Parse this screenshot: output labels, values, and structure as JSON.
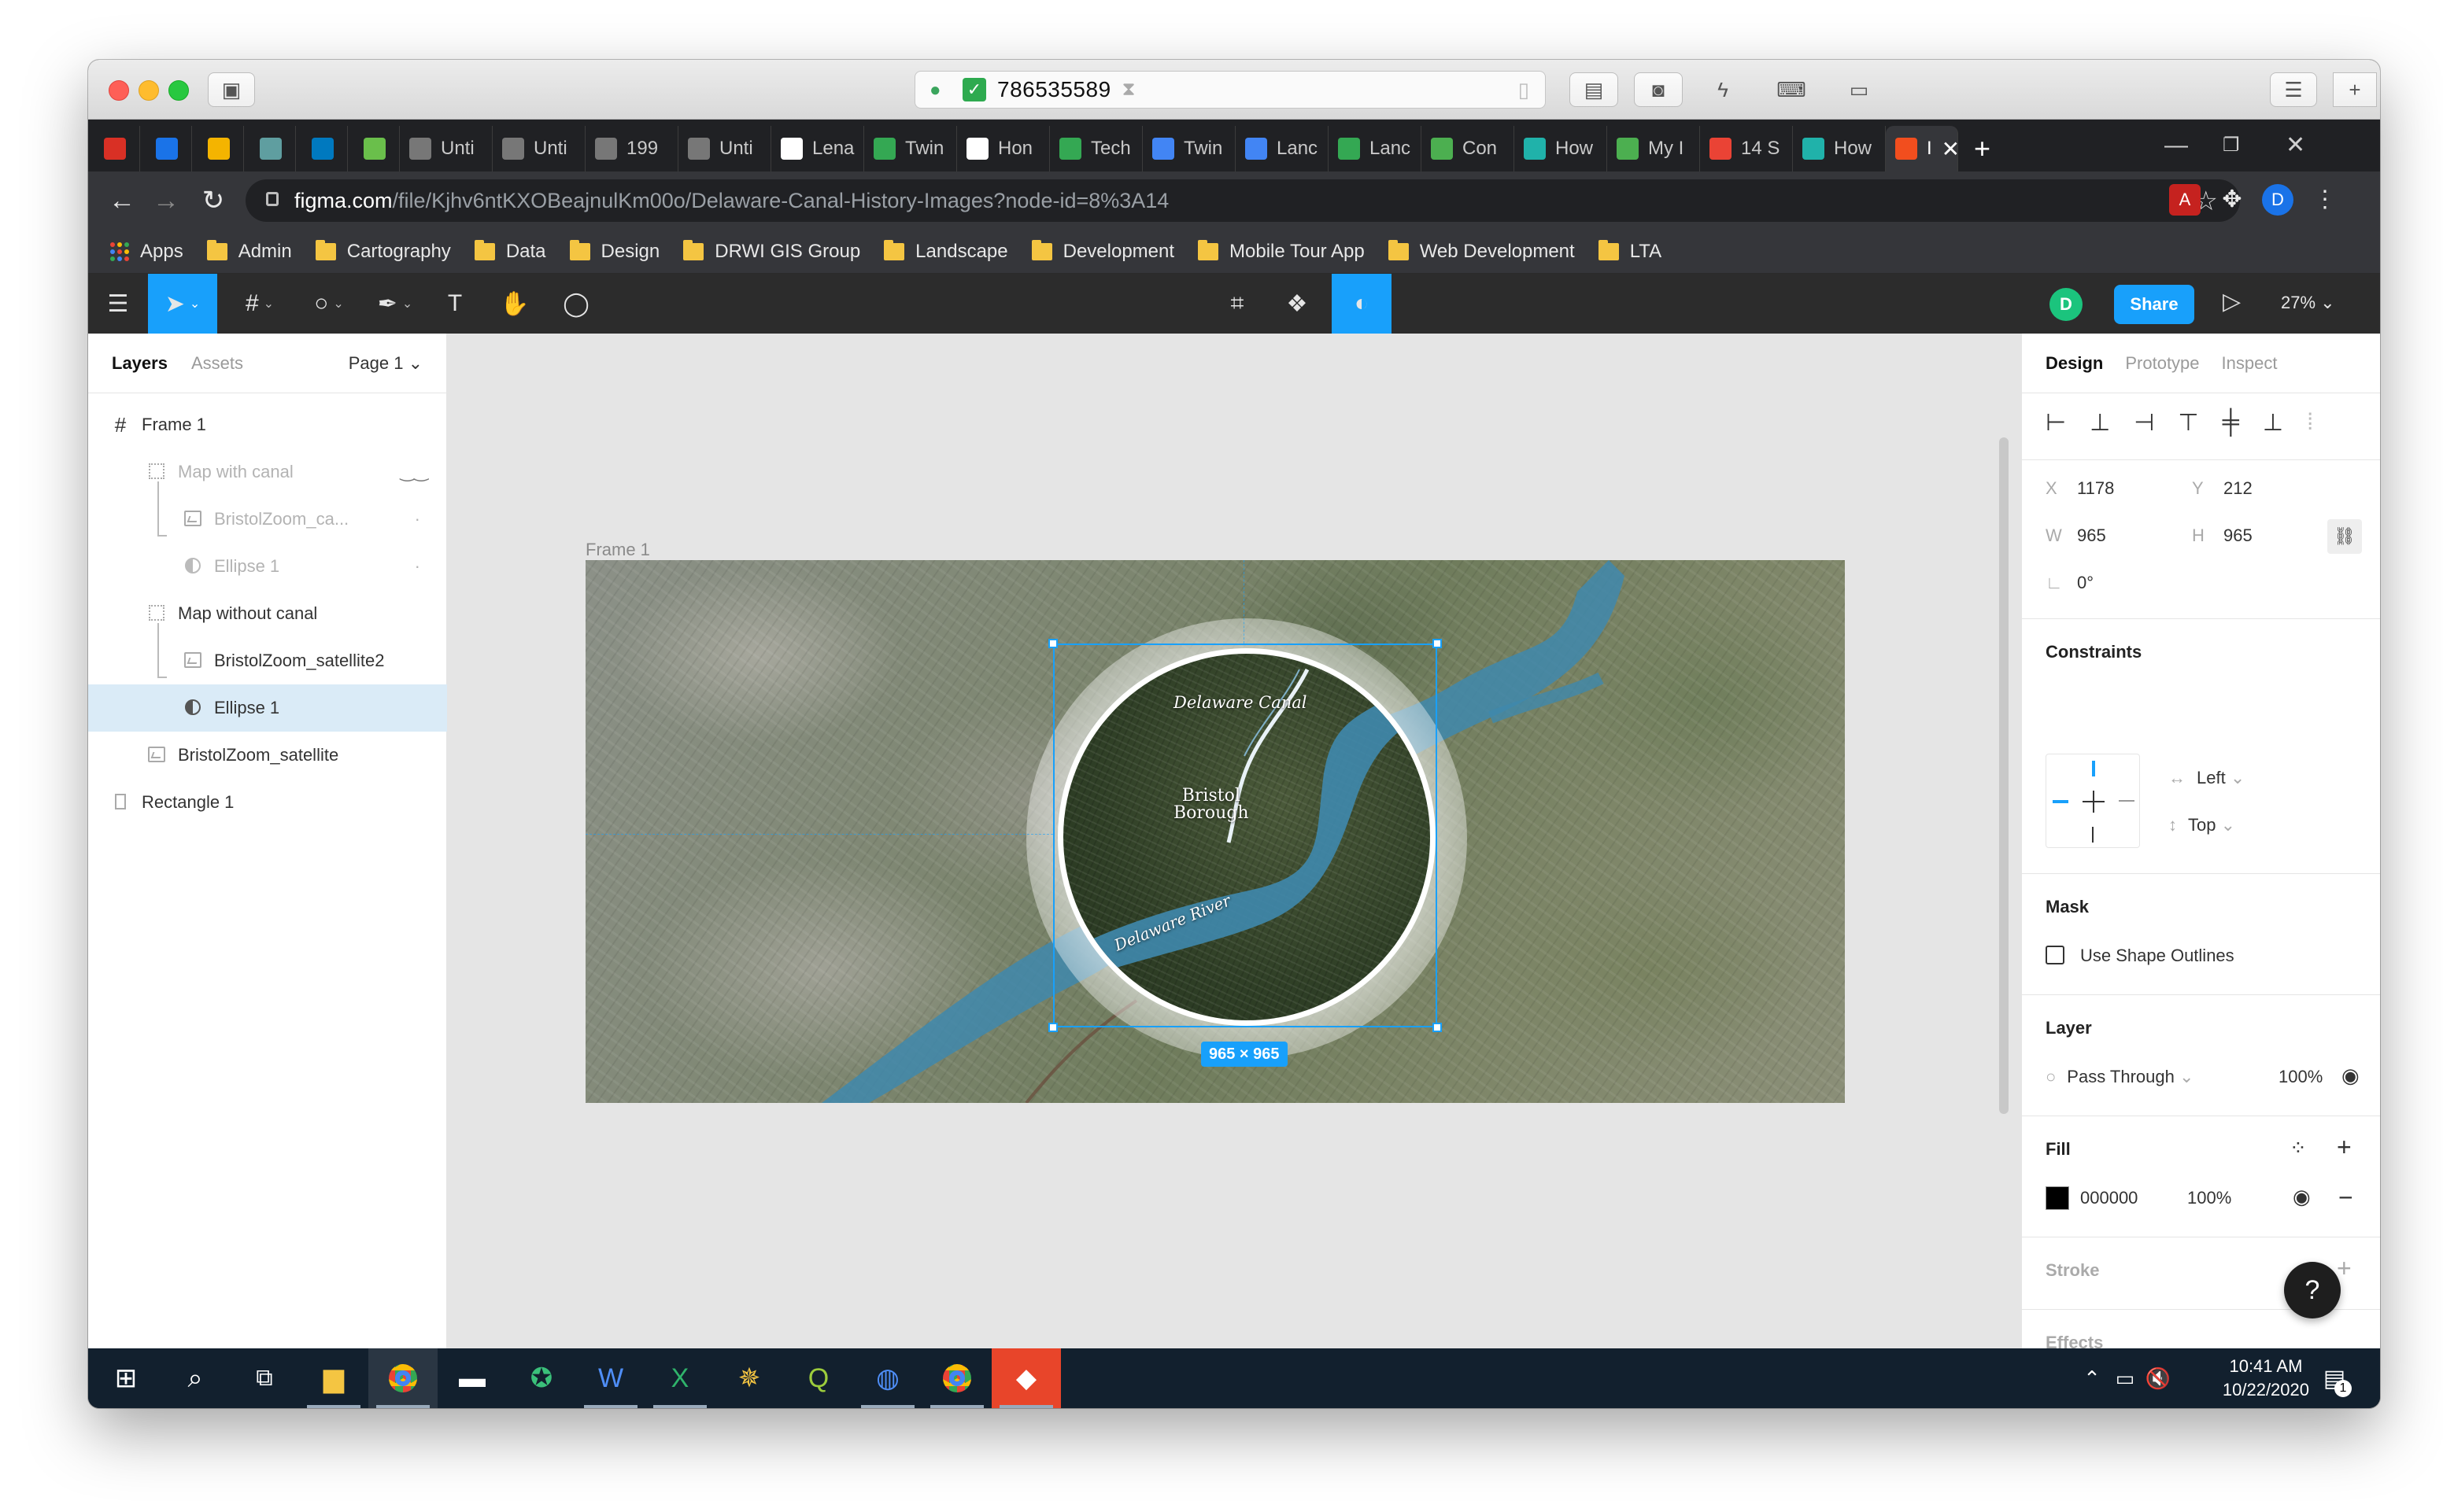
{
  "mac": {
    "address_id": "786535589"
  },
  "tabs": [
    {
      "label": "",
      "icon": "gmail-icon",
      "color": "#d93025"
    },
    {
      "label": "",
      "icon": "calendar-icon",
      "color": "#1a73e8"
    },
    {
      "label": "",
      "icon": "drive-icon",
      "color": "#f4b400"
    },
    {
      "label": "",
      "icon": "grid-app-icon",
      "color": "#5f9ea0"
    },
    {
      "label": "",
      "icon": "trello-icon",
      "color": "#0079bf"
    },
    {
      "label": "",
      "icon": "tab-green-icon",
      "color": "#6abf4b"
    },
    {
      "label": "Unti",
      "icon": "loading-icon",
      "color": "#777777"
    },
    {
      "label": "Unti",
      "icon": "loading-icon",
      "color": "#777777"
    },
    {
      "label": "199",
      "icon": "loading-icon",
      "color": "#777777"
    },
    {
      "label": "Unti",
      "icon": "loading-icon",
      "color": "#777777"
    },
    {
      "label": "Lena",
      "icon": "wikipedia-icon",
      "color": "#ffffff"
    },
    {
      "label": "Twin",
      "icon": "doc-green-icon",
      "color": "#34a853"
    },
    {
      "label": "Hon",
      "icon": "wix-icon",
      "color": "#ffffff"
    },
    {
      "label": "Tech",
      "icon": "plus-green-icon",
      "color": "#34a853"
    },
    {
      "label": "Twin",
      "icon": "docs-icon",
      "color": "#4285f4"
    },
    {
      "label": "Lanc",
      "icon": "docs-icon",
      "color": "#4285f4"
    },
    {
      "label": "Lanc",
      "icon": "plus-green-icon",
      "color": "#34a853"
    },
    {
      "label": "Con",
      "icon": "globe-icon",
      "color": "#4caf50"
    },
    {
      "label": "How",
      "icon": "qgis-icon",
      "color": "#20b2aa"
    },
    {
      "label": "My I",
      "icon": "globe-icon",
      "color": "#4caf50"
    },
    {
      "label": "14 S",
      "icon": "maps-pin-icon",
      "color": "#ea4335"
    },
    {
      "label": "How",
      "icon": "qgis-icon",
      "color": "#20b2aa"
    },
    {
      "label": "I",
      "icon": "figma-icon",
      "color": "#f24e1e",
      "active": true
    }
  ],
  "browser": {
    "url_host": "figma.com",
    "url_path": "/file/Kjhv6ntKXOBeajnulKm00o/Delaware-Canal-History-Images?node-id=8%3A14",
    "profile_initial": "D"
  },
  "bookmarks": [
    "Apps",
    "Admin",
    "Cartography",
    "Data",
    "Design",
    "DRWI GIS Group",
    "Landscape",
    "Development",
    "Mobile Tour App",
    "Web Development",
    "LTA"
  ],
  "figma": {
    "user_initial": "D",
    "share_label": "Share",
    "zoom": "27%",
    "accent": "#18a0fb"
  },
  "layers_panel": {
    "tab_layers": "Layers",
    "tab_assets": "Assets",
    "page": "Page 1",
    "items": [
      {
        "label": "Frame 1"
      },
      {
        "label": "Map with canal"
      },
      {
        "label": "BristolZoom_ca..."
      },
      {
        "label": "Ellipse 1"
      },
      {
        "label": "Map without canal"
      },
      {
        "label": "BristolZoom_satellite2"
      },
      {
        "label": "Ellipse 1"
      },
      {
        "label": "BristolZoom_satellite"
      },
      {
        "label": "Rectangle 1"
      }
    ]
  },
  "canvas": {
    "frame_label": "Frame 1",
    "dimension_badge": "965 × 965",
    "map_labels": {
      "canal": "Delaware Canal",
      "borough_line1": "Bristol",
      "borough_line2": "Borough",
      "river": "Delaware River"
    }
  },
  "design_panel": {
    "tab_design": "Design",
    "tab_prototype": "Prototype",
    "tab_inspect": "Inspect",
    "x_label": "X",
    "x_value": "1178",
    "y_label": "Y",
    "y_value": "212",
    "w_label": "W",
    "w_value": "965",
    "h_label": "H",
    "h_value": "965",
    "rotation": "0°",
    "constraints_title": "Constraints",
    "constraint_h": "Left",
    "constraint_v": "Top",
    "mask_title": "Mask",
    "mask_option": "Use Shape Outlines",
    "layer_title": "Layer",
    "blend_mode": "Pass Through",
    "layer_opacity": "100%",
    "fill_title": "Fill",
    "fill_hex": "000000",
    "fill_opacity": "100%",
    "stroke_title": "Stroke",
    "effects_title": "Effects",
    "help": "?"
  },
  "taskbar": {
    "time": "10:41 AM",
    "date": "10/22/2020",
    "notifications": "1"
  }
}
